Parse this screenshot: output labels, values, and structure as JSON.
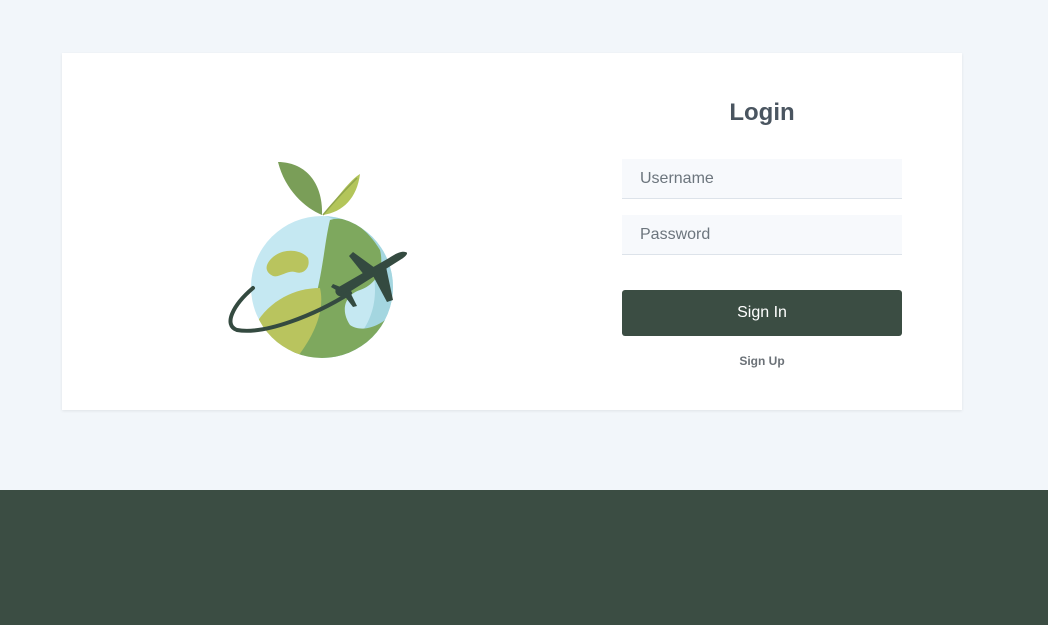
{
  "login": {
    "title": "Login",
    "username_placeholder": "Username",
    "password_placeholder": "Password",
    "signin_label": "Sign In",
    "signup_label": "Sign Up"
  },
  "logo": {
    "icon": "globe-airplane-leaf-icon"
  },
  "colors": {
    "page_background": "#f2f6fa",
    "card_background": "#ffffff",
    "accent_dark_green": "#3b4d43",
    "globe_light_blue": "#c5e8f2",
    "globe_mid_blue": "#a4d6e0",
    "land_green": "#7ea85e",
    "land_yellow_green": "#b9c45e"
  }
}
